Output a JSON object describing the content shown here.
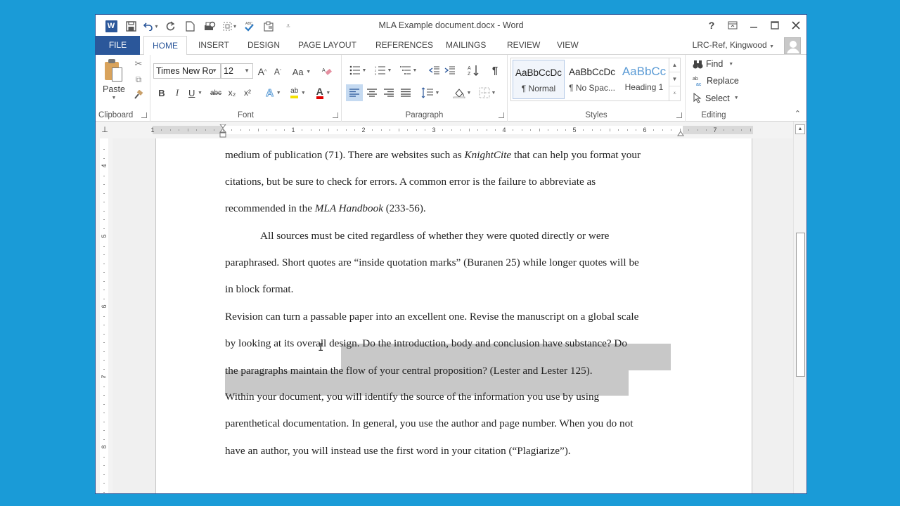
{
  "window": {
    "title": "MLA Example document.docx - Word",
    "controls": [
      {
        "name": "help-icon",
        "glyph": "?"
      },
      {
        "name": "ribbon-display-options-icon",
        "glyph": "⊡"
      },
      {
        "name": "minimize-icon",
        "glyph": "—"
      },
      {
        "name": "maximize-icon",
        "glyph": "☐"
      },
      {
        "name": "close-icon",
        "glyph": "✕"
      }
    ]
  },
  "quick_access": [
    {
      "name": "word-app-icon",
      "glyph": "W"
    },
    {
      "name": "save-icon",
      "glyph": "💾"
    },
    {
      "name": "undo-icon",
      "glyph": "↶"
    },
    {
      "name": "redo-icon",
      "glyph": "↻"
    },
    {
      "name": "new-document-icon",
      "glyph": "🗋"
    },
    {
      "name": "print-preview-icon",
      "glyph": "🖶"
    },
    {
      "name": "select-object-icon",
      "glyph": "⬚"
    },
    {
      "name": "spelling-grammar-icon",
      "glyph": "✓"
    },
    {
      "name": "clipboard-capture-icon",
      "glyph": "📋"
    },
    {
      "name": "customize-qat-icon",
      "glyph": "⩡"
    }
  ],
  "tabs": [
    {
      "label": "FILE"
    },
    {
      "label": "HOME",
      "active": true
    },
    {
      "label": "INSERT"
    },
    {
      "label": "DESIGN"
    },
    {
      "label": "PAGE LAYOUT"
    },
    {
      "label": "REFERENCES"
    },
    {
      "label": "MAILINGS"
    },
    {
      "label": "REVIEW"
    },
    {
      "label": "VIEW"
    }
  ],
  "account": {
    "name": "LRC-Ref, Kingwood"
  },
  "ribbon": {
    "clipboard": {
      "label": "Clipboard",
      "paste": "Paste",
      "cut_glyph": "✂",
      "copy_glyph": "⧉",
      "format_painter_glyph": "🖌"
    },
    "font": {
      "label": "Font",
      "font_name": "Times New Ro",
      "font_size": "12",
      "grow_glyph": "A",
      "shrink_glyph": "A",
      "change_case": "Aa",
      "clear_format_glyph": "✎",
      "bold": "B",
      "italic": "I",
      "underline": "U",
      "strikethrough": "abc",
      "subscript": "x₂",
      "superscript": "x²",
      "text_effects": "A",
      "highlight": "ab",
      "font_color": "A"
    },
    "paragraph": {
      "label": "Paragraph",
      "bullets_glyph": "☰",
      "numbering_glyph": "☷",
      "multilevel_glyph": "☰",
      "decrease_indent_glyph": "⇤",
      "increase_indent_glyph": "⇥",
      "sort_glyph": "A↓",
      "show_marks_glyph": "¶",
      "align_left_glyph": "≡",
      "center_glyph": "≡",
      "align_right_glyph": "≡",
      "justify_glyph": "≡",
      "line_spacing_glyph": "↕≡",
      "shading_glyph": "◈",
      "borders_glyph": "⊞"
    },
    "styles": {
      "label": "Styles",
      "items": [
        {
          "sample": "AaBbCcDc",
          "name": "¶ Normal",
          "selected": true
        },
        {
          "sample": "AaBbCcDc",
          "name": "¶ No Spac..."
        },
        {
          "sample": "AaBbCc",
          "name": "Heading 1"
        }
      ]
    },
    "editing": {
      "label": "Editing",
      "find": "Find",
      "replace": "Replace",
      "select": "Select"
    }
  },
  "ruler": {
    "horizontal_labels": [
      "1",
      "1",
      "2",
      "3",
      "4",
      "5",
      "6",
      "7"
    ],
    "vertical_labels": [
      "4",
      "5",
      "6",
      "7",
      "8"
    ]
  },
  "document": {
    "lines": [
      {
        "parts": [
          {
            "t": "medium of publication (71). There are websites such as "
          },
          {
            "t": "KnightCite",
            "i": true
          },
          {
            "t": " that can help you format your"
          }
        ]
      },
      {
        "parts": [
          {
            "t": "citations, but be sure to check for errors. A common error is the failure to abbreviate as"
          }
        ]
      },
      {
        "parts": [
          {
            "t": "recommended in the "
          },
          {
            "t": "MLA Handbook",
            "i": true
          },
          {
            "t": " (233-56)."
          }
        ]
      },
      {
        "parts": [
          {
            "t": "All sources must be cited regardless of whether they were quoted directly or were"
          }
        ],
        "indent": true
      },
      {
        "parts": [
          {
            "t": "paraphrased. Short quotes are “inside quotation marks” (Buranen 25) while longer quotes will be"
          }
        ]
      },
      {
        "parts": [
          {
            "t": "in block format."
          }
        ]
      },
      {
        "parts": [
          {
            "t": "Revision can turn a passable paper into an excellent one. Revise the manuscript on a global scale"
          }
        ]
      },
      {
        "parts": [
          {
            "t": "by looking at its overall "
          },
          {
            "t": "design. Do the introduction, body and conclusion have substance? Do",
            "h": true
          }
        ]
      },
      {
        "parts": [
          {
            "t": "the paragraphs maintain the flow of your central proposition? (Lester and Lester 125).",
            "h": true
          }
        ]
      },
      {
        "parts": [
          {
            "t": "Within your document, you will identify the source of the information you use by using"
          }
        ]
      },
      {
        "parts": [
          {
            "t": "parenthetical documentation. In general, you use the author and page number. When you do not"
          }
        ]
      },
      {
        "parts": [
          {
            "t": "have an author, you will instead use the first word in your citation (“Plagiarize”)."
          }
        ]
      }
    ]
  },
  "scrollbar": {
    "position_fraction": 0.45
  }
}
